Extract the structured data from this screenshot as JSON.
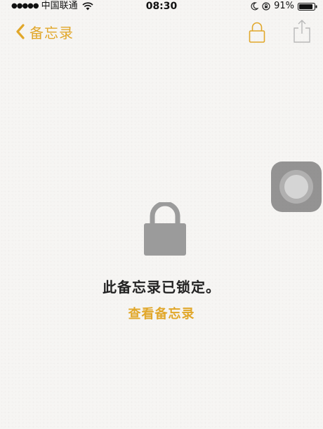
{
  "status_bar": {
    "signal_dots": "●●●●●",
    "carrier": "中国联通",
    "time": "08:30",
    "battery_percent": "91%",
    "battery_level": 0.91,
    "icons": [
      "signal-dots",
      "wifi-icon",
      "moon-icon",
      "rotation-lock-icon",
      "battery-icon"
    ]
  },
  "nav_bar": {
    "back_label": "备忘录",
    "icons": [
      "chevron-left-icon",
      "lock-icon",
      "share-icon"
    ]
  },
  "main": {
    "locked_message": "此备忘录已锁定。",
    "view_link": "查看备忘录",
    "icons": [
      "padlock-icon"
    ]
  },
  "overlay": {
    "assistive_touch": "assistive-touch-button"
  },
  "colors": {
    "accent": "#e1a72a",
    "background": "#f6f5f3",
    "padlock": "#9b9b9b",
    "text": "#222222"
  }
}
